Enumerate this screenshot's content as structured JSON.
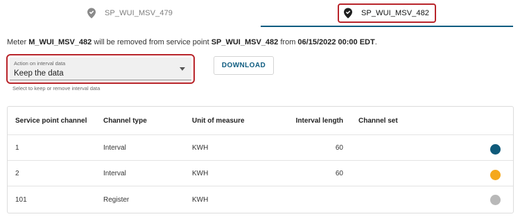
{
  "tabs": [
    {
      "label": "SP_WUI_MSV_479",
      "icon": "location-pin-check-icon",
      "active": false
    },
    {
      "label": "SP_WUI_MSV_482",
      "icon": "location-pin-check-icon",
      "active": true
    }
  ],
  "message": {
    "part1": "Meter ",
    "meter": "M_WUI_MSV_482",
    "part2": " will be removed from service point ",
    "service_point": "SP_WUI_MSV_482",
    "part3": " from ",
    "datetime": "06/15/2022 00:00 EDT",
    "part4": "."
  },
  "action_select": {
    "label": "Action on interval data",
    "value": "Keep the data",
    "helper": "Select to keep or remove interval data"
  },
  "download_label": "DOWNLOAD",
  "table": {
    "columns": [
      "Service point channel",
      "Channel type",
      "Unit of measure",
      "Interval length",
      "Channel set"
    ],
    "rows": [
      {
        "channel": "1",
        "type": "Interval",
        "unit": "KWH",
        "interval": "60",
        "color": "#0f5a7a"
      },
      {
        "channel": "2",
        "type": "Interval",
        "unit": "KWH",
        "interval": "60",
        "color": "#f5a81c"
      },
      {
        "channel": "101",
        "type": "Register",
        "unit": "KWH",
        "interval": "",
        "color": "#b8b8b8"
      }
    ]
  }
}
